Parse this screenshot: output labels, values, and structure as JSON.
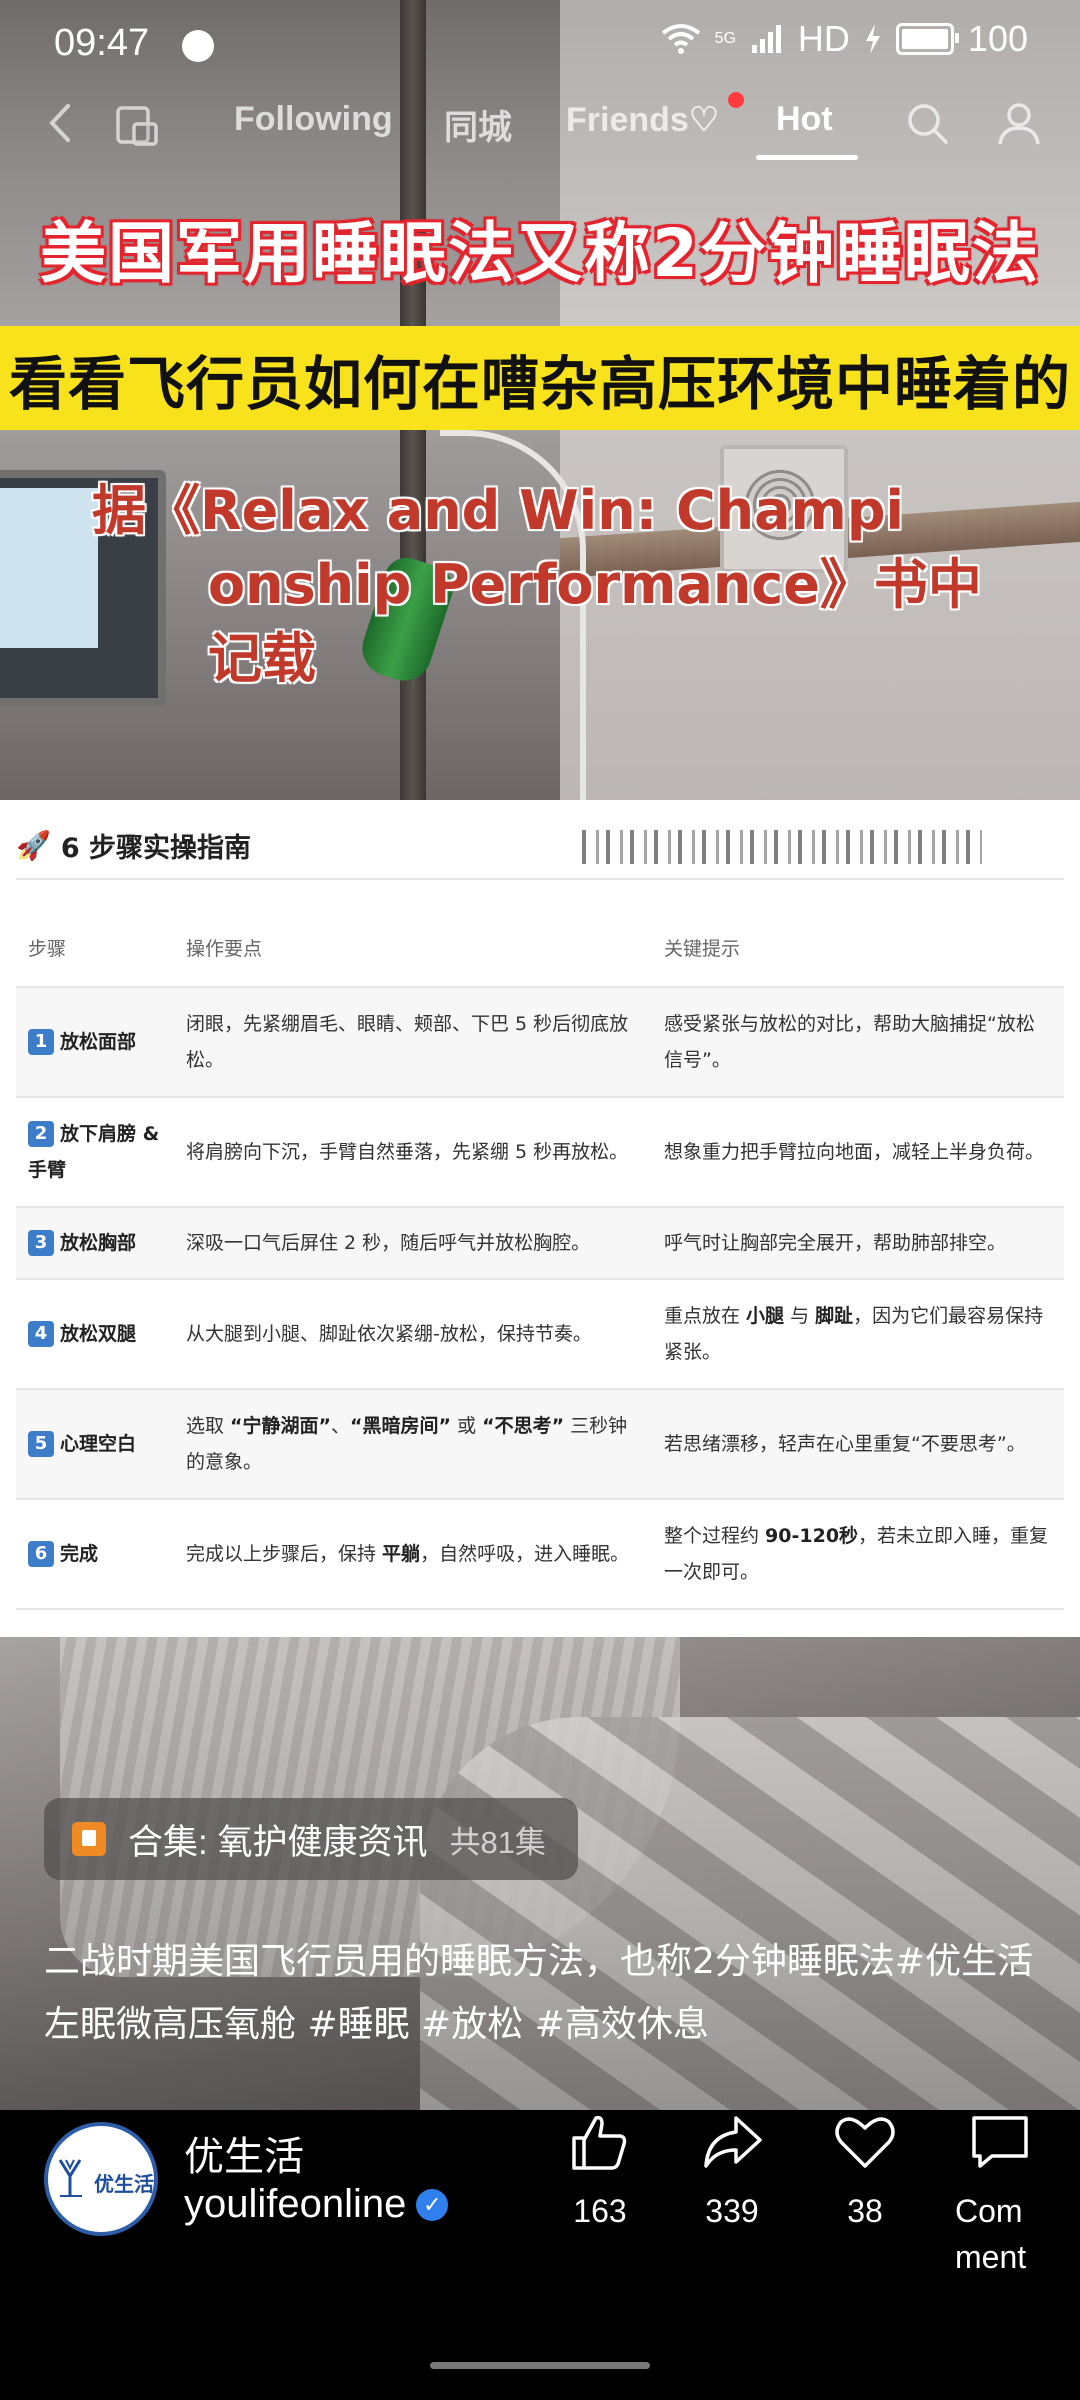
{
  "status_bar": {
    "time": "09:47",
    "network": "5G",
    "hd": "HD",
    "battery": "100"
  },
  "top_nav": {
    "tabs": [
      {
        "label": "Following",
        "active": false
      },
      {
        "label": "同城",
        "active": false
      },
      {
        "label": "Friends♡",
        "active": false
      },
      {
        "label": "Hot",
        "active": true
      }
    ]
  },
  "video": {
    "title_line1": "美国军用睡眠法又称2分钟睡眠法",
    "title_line2": "看看飞行员如何在嘈杂高压环境中睡着的",
    "title_line3a": "据《Relax and Win: Champi",
    "title_line3b": "onship Performance》书中记载"
  },
  "guide": {
    "heading": "6 步骤实操指南",
    "columns": [
      "步骤",
      "操作要点",
      "关键提示"
    ],
    "rows": [
      {
        "num": "1",
        "step": "放松面部",
        "ops": "闭眼，先紧绷眉毛、眼睛、颊部、下巴 5 秒后彻底放松。",
        "tip": "感受紧张与放松的对比，帮助大脑捕捉“放松信号”。"
      },
      {
        "num": "2",
        "step": "放下肩膀 & 手臂",
        "ops": "将肩膀向下沉，手臂自然垂落，先紧绷 5 秒再放松。",
        "tip": "想象重力把手臂拉向地面，减轻上半身负荷。"
      },
      {
        "num": "3",
        "step": "放松胸部",
        "ops": "深吸一口气后屏住 2 秒，随后呼气并放松胸腔。",
        "tip": "呼气时让胸部完全展开，帮助肺部排空。"
      },
      {
        "num": "4",
        "step": "放松双腿",
        "ops": "从大腿到小腿、脚趾依次紧绷-放松，保持节奏。",
        "tip_a": "重点放在 ",
        "tip_b": "小腿",
        "tip_c": " 与 ",
        "tip_d": "脚趾",
        "tip_e": "，因为它们最容易保持紧张。"
      },
      {
        "num": "5",
        "step": "心理空白",
        "ops_a": "选取 ",
        "ops_b": "“宁静湖面”",
        "ops_c": "、",
        "ops_d": "“黑暗房间”",
        "ops_e": " 或 ",
        "ops_f": "“不思考”",
        "ops_g": " 三秒钟的意象。",
        "tip": "若思绪漂移，轻声在心里重复“不要思考”。"
      },
      {
        "num": "6",
        "step": "完成",
        "ops_a": "完成以上步骤后，保持 ",
        "ops_b": "平躺",
        "ops_c": "，自然呼吸，进入睡眠。",
        "tip_a": "整个过程约 ",
        "tip_b": "90-120秒",
        "tip_c": "，若未立即入睡，重复一次即可。"
      }
    ]
  },
  "collection": {
    "label": "合集: 氧护健康资讯",
    "count": "共81集"
  },
  "caption": "二战时期美国飞行员用的睡眠方法，也称2分钟睡眠法#优生活左眠微高压氧舱 #睡眠  #放松 #高效休息",
  "author": {
    "name": "优生活",
    "id": "youlifeonline",
    "avatar_text": "优生活"
  },
  "actions": {
    "like_count": "163",
    "share_count": "339",
    "favorite_count": "38",
    "comment_label": "Comment"
  }
}
